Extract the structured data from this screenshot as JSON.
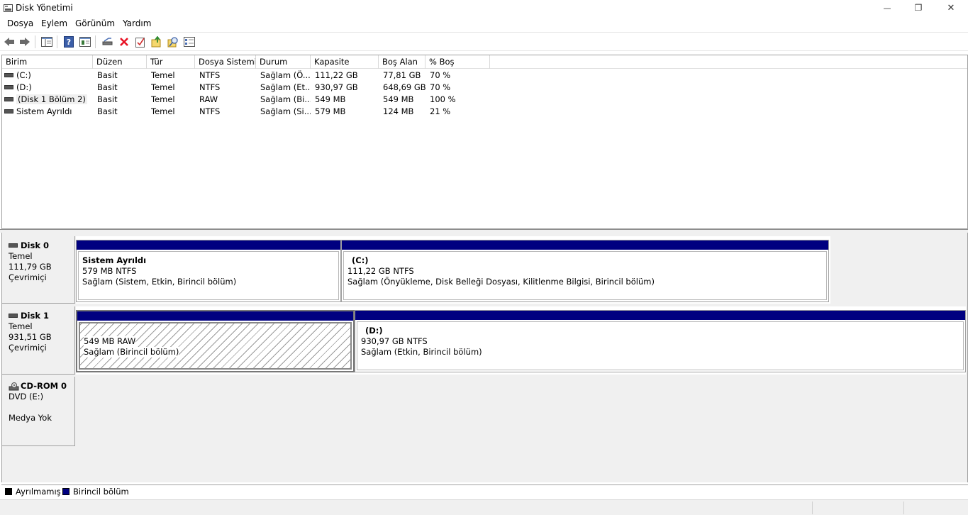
{
  "window": {
    "title": "Disk Yönetimi",
    "minimize_glyph": "—",
    "maximize_glyph": "❐",
    "close_glyph": "✕"
  },
  "menu": [
    "Dosya",
    "Eylem",
    "Görünüm",
    "Yardım"
  ],
  "toolbar": {
    "icons": [
      "back-icon",
      "forward-icon",
      "show-hide-console-tree-icon",
      "help-icon",
      "properties-icon",
      "connect-drive-icon",
      "delete-icon",
      "check-icon",
      "export-list-icon",
      "find-icon",
      "properties-sheet-icon"
    ],
    "delete_color": "#e81123"
  },
  "volume_list": {
    "columns": [
      "Birim",
      "Düzen",
      "Tür",
      "Dosya Sistemi",
      "Durum",
      "Kapasite",
      "Boş Alan",
      "% Boş"
    ],
    "rows": [
      [
        "(C:)",
        "Basit",
        "Temel",
        "NTFS",
        "Sağlam (Ö...",
        "111,22 GB",
        "77,81 GB",
        "70 %"
      ],
      [
        "(D:)",
        "Basit",
        "Temel",
        "NTFS",
        "Sağlam (Et...",
        "930,97 GB",
        "648,69 GB",
        "70 %"
      ],
      [
        "(Disk 1 Bölüm 2)",
        "Basit",
        "Temel",
        "RAW",
        "Sağlam (Bi...",
        "549 MB",
        "549 MB",
        "100 %"
      ],
      [
        "Sistem Ayrıldı",
        "Basit",
        "Temel",
        "NTFS",
        "Sağlam (Si...",
        "579 MB",
        "124 MB",
        "21 %"
      ]
    ]
  },
  "disks": [
    {
      "name": "Disk 0",
      "type": "Temel",
      "size": "111,79 GB",
      "status": "Çevrimiçi",
      "partitions": [
        {
          "title": "Sistem Ayrıldı",
          "line1": "579 MB NTFS",
          "line2": "Sağlam (Sistem, Etkin, Birincil bölüm)"
        },
        {
          "title": "(C:)",
          "line1": "111,22 GB NTFS",
          "line2": "Sağlam (Önyükleme, Disk Belleği Dosyası, Kilitlenme Bilgisi, Birincil bölüm)"
        }
      ]
    },
    {
      "name": "Disk 1",
      "type": "Temel",
      "size": "931,51 GB",
      "status": "Çevrimiçi",
      "partitions": [
        {
          "title": "",
          "line1": "549 MB RAW",
          "line2": "Sağlam (Birincil bölüm)"
        },
        {
          "title": "(D:)",
          "line1": "930,97 GB NTFS",
          "line2": "Sağlam (Etkin, Birincil bölüm)"
        }
      ]
    },
    {
      "name": "CD-ROM 0",
      "type": "DVD (E:)",
      "status": "Medya Yok"
    }
  ],
  "legend": [
    {
      "label": "Ayrılmamış",
      "color": "#000000"
    },
    {
      "label": "Birincil bölüm",
      "color": "#000080"
    }
  ],
  "colors": {
    "partition_bar": "#000080",
    "unallocated": "#000000"
  }
}
